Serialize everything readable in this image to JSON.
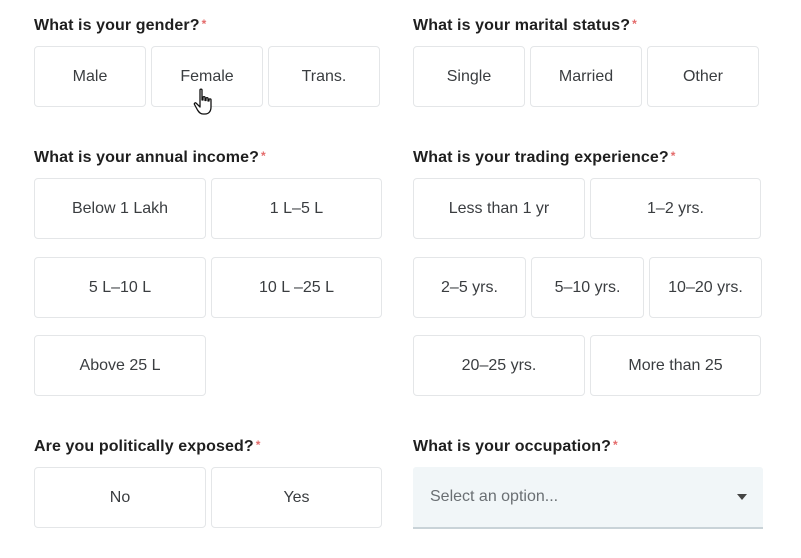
{
  "gender": {
    "question": "What is your gender?",
    "required_mark": "*",
    "options": [
      "Male",
      "Female",
      "Trans."
    ]
  },
  "marital": {
    "question": "What is your marital status?",
    "required_mark": "*",
    "options": [
      "Single",
      "Married",
      "Other"
    ]
  },
  "income": {
    "question": "What is your annual income?",
    "required_mark": "*",
    "options": [
      "Below 1 Lakh",
      "1 L–5 L",
      "5 L–10 L",
      "10 L –25 L",
      "Above 25 L"
    ]
  },
  "experience": {
    "question": "What is your trading experience?",
    "required_mark": "*",
    "options": [
      "Less than 1 yr",
      "1–2 yrs.",
      "2–5 yrs.",
      "5–10 yrs.",
      "10–20 yrs.",
      "20–25 yrs.",
      "More than 25"
    ]
  },
  "political": {
    "question": "Are you politically exposed?",
    "required_mark": "*",
    "options": [
      "No",
      "Yes"
    ]
  },
  "occupation": {
    "question": "What is your occupation?",
    "required_mark": "*",
    "placeholder": "Select an option..."
  },
  "colors": {
    "required": "#e46b6b",
    "select_bg": "#f1f6f8",
    "border": "#e4e6e8"
  }
}
